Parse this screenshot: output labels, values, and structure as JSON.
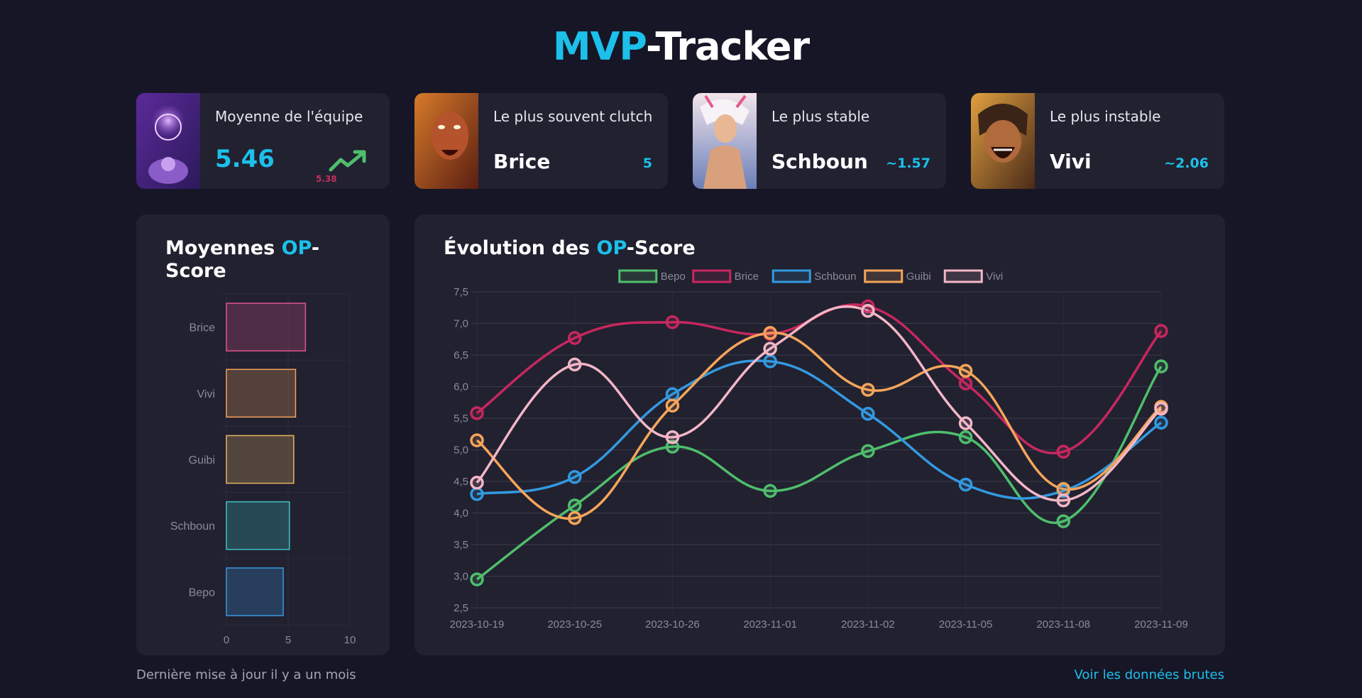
{
  "header": {
    "title_accent": "MVP",
    "title_rest": "-Tracker"
  },
  "cards": [
    {
      "label": "Moyenne de l'équipe",
      "value": "5.46",
      "previous": "5.38"
    },
    {
      "label": "Le plus souvent clutch",
      "name": "Brice",
      "value": "5"
    },
    {
      "label": "Le plus stable",
      "name": "Schboun",
      "value": "~1.57"
    },
    {
      "label": "Le plus instable",
      "name": "Vivi",
      "value": "~2.06"
    }
  ],
  "bar_panel": {
    "title_a": "Moyennes ",
    "title_accent": "OP",
    "title_b": "-",
    "title_c": "Score"
  },
  "line_panel": {
    "title_a": "Évolution des ",
    "title_accent": "OP",
    "title_b": "-Score"
  },
  "footer": {
    "updated": "Dernière mise à jour il y a un mois",
    "raw_link": "Voir les données brutes"
  },
  "colors": {
    "accent": "#1cc0ea",
    "background": "#161626",
    "panel": "#212130"
  },
  "chart_data": [
    {
      "type": "bar",
      "orientation": "horizontal",
      "categories": [
        "Brice",
        "Vivi",
        "Guibi",
        "Schboun",
        "Bepo"
      ],
      "values": [
        6.4,
        5.6,
        5.45,
        5.1,
        4.6
      ],
      "colors": [
        "#e0538a",
        "#f5a25b",
        "#e8b463",
        "#3dc2c2",
        "#3a97e0"
      ],
      "xlim": [
        0,
        10
      ],
      "xticks": [
        "0",
        "5",
        "10"
      ],
      "grid": true
    },
    {
      "type": "line",
      "x": [
        "2023-10-19",
        "2023-10-25",
        "2023-10-26",
        "2023-11-01",
        "2023-11-02",
        "2023-11-05",
        "2023-11-08",
        "2023-11-09"
      ],
      "ylim": [
        2.5,
        7.5
      ],
      "yticks": [
        "2,5",
        "3,0",
        "3,5",
        "4,0",
        "4,5",
        "5,0",
        "5,5",
        "6,0",
        "6,5",
        "7,0",
        "7,5"
      ],
      "legend": "top",
      "grid": true,
      "series": [
        {
          "name": "Bepo",
          "color": "#4fbe6c",
          "values": [
            2.95,
            4.12,
            5.05,
            4.35,
            4.98,
            5.2,
            3.87,
            6.32
          ]
        },
        {
          "name": "Brice",
          "color": "#c7275e",
          "values": [
            5.58,
            6.77,
            7.02,
            6.83,
            7.27,
            6.05,
            4.97,
            6.88
          ]
        },
        {
          "name": "Schboun",
          "color": "#3399e0",
          "values": [
            4.3,
            4.57,
            5.88,
            6.4,
            5.57,
            4.45,
            4.35,
            5.43
          ]
        },
        {
          "name": "Guibi",
          "color": "#f5a55a",
          "values": [
            5.15,
            3.92,
            5.7,
            6.85,
            5.95,
            6.25,
            4.38,
            5.68
          ]
        },
        {
          "name": "Vivi",
          "color": "#f3b6c6",
          "values": [
            4.48,
            6.35,
            5.2,
            6.6,
            7.2,
            5.42,
            4.2,
            5.65
          ]
        }
      ]
    }
  ]
}
